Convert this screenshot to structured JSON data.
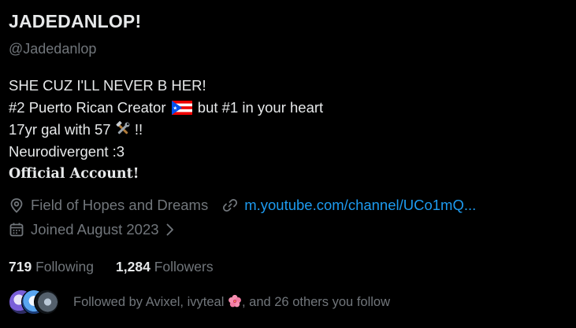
{
  "profile": {
    "display_name": "JADEDANLOP!",
    "handle": "@Jadedanlop"
  },
  "bio": {
    "line1": "SHE CUZ I'LL NEVER B HER!",
    "line2_before": "#2 Puerto Rican Creator",
    "line2_after": "but #1 in your heart",
    "line3_before": "17yr gal with 57",
    "line3_after": "!!",
    "line4": "Neurodivergent :3",
    "line5": "Official Account!"
  },
  "meta": {
    "location": "Field of Hopes and Dreams",
    "website": "m.youtube.com/channel/UCo1mQ...",
    "joined": "Joined August 2023"
  },
  "counts": {
    "following_num": "719",
    "following_label": "Following",
    "followers_num": "1,284",
    "followers_label": "Followers"
  },
  "followed_by": {
    "before": "Followed by Avixel, ivyteal",
    "after": ", and 26 others you follow"
  },
  "icons": {
    "location": "location-pin-icon",
    "link": "link-icon",
    "calendar": "calendar-icon",
    "chevron": "chevron-right-icon",
    "flag": "puerto-rico-flag-icon",
    "tools": "hammer-and-wrench-icon",
    "flower": "hibiscus-icon"
  },
  "colors": {
    "background": "#000000",
    "text": "#e7e9ea",
    "muted": "#71767b",
    "link": "#1d9bf0"
  }
}
